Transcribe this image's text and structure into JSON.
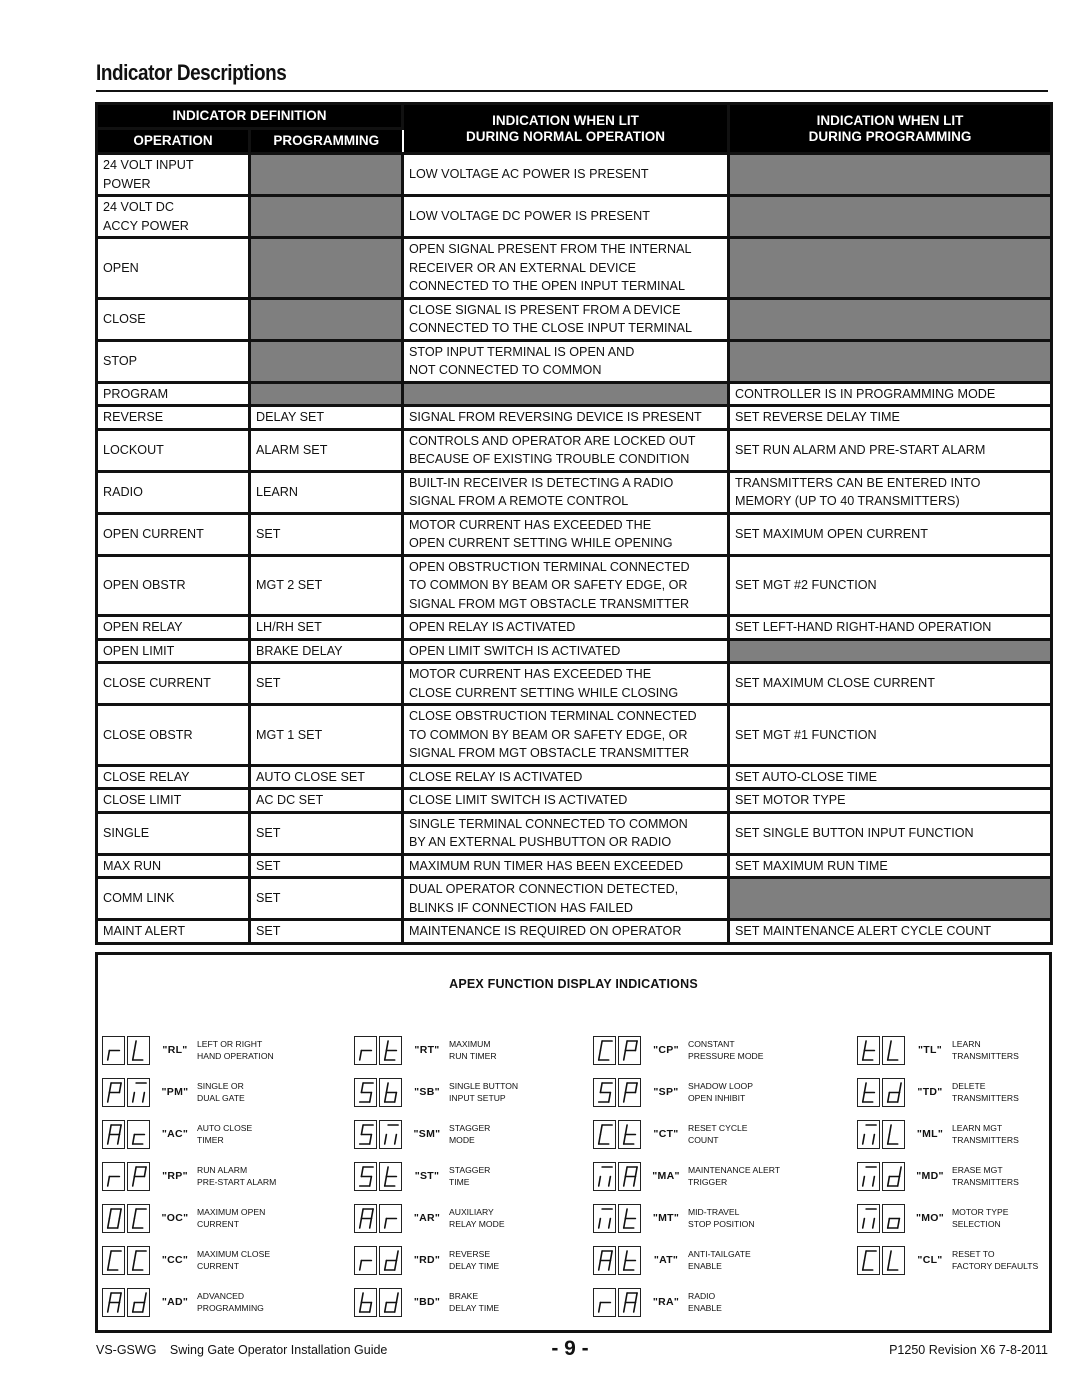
{
  "page": {
    "title": "Indicator Descriptions"
  },
  "table": {
    "headers": {
      "indicator_definition": "INDICATOR DEFINITION",
      "operation": "OPERATION",
      "programming": "PROGRAMMING",
      "lit_normal_line1": "INDICATION WHEN LIT",
      "lit_normal_line2": "DURING NORMAL OPERATION",
      "lit_prog_line1": "INDICATION WHEN LIT",
      "lit_prog_line2": "DURING PROGRAMMING"
    },
    "rows": [
      {
        "operation": "24 VOLT INPUT\nPOWER",
        "programming": null,
        "normal": "LOW VOLTAGE AC POWER IS PRESENT",
        "prog": null
      },
      {
        "operation": "24 VOLT DC\nACCY POWER",
        "programming": null,
        "normal": "LOW VOLTAGE DC POWER IS PRESENT",
        "prog": null
      },
      {
        "operation": "OPEN",
        "programming": null,
        "normal": "OPEN SIGNAL PRESENT FROM THE INTERNAL\nRECEIVER OR AN EXTERNAL DEVICE\nCONNECTED TO THE OPEN INPUT TERMINAL",
        "prog": null
      },
      {
        "operation": "CLOSE",
        "programming": null,
        "normal": "CLOSE SIGNAL IS PRESENT FROM A DEVICE\nCONNECTED TO THE CLOSE INPUT TERMINAL",
        "prog": null
      },
      {
        "operation": "STOP",
        "programming": null,
        "normal": "STOP INPUT TERMINAL IS OPEN AND\nNOT CONNECTED TO COMMON",
        "prog": null
      },
      {
        "operation": "PROGRAM",
        "programming": null,
        "normal": null,
        "prog": "CONTROLLER IS IN PROGRAMMING MODE"
      },
      {
        "operation": "REVERSE",
        "programming": "DELAY SET",
        "normal": "SIGNAL FROM REVERSING DEVICE IS PRESENT",
        "prog": "SET REVERSE DELAY TIME"
      },
      {
        "operation": "LOCKOUT",
        "programming": "ALARM SET",
        "normal": "CONTROLS AND OPERATOR ARE LOCKED OUT\nBECAUSE OF EXISTING TROUBLE CONDITION",
        "prog": "SET RUN ALARM AND PRE-START ALARM"
      },
      {
        "operation": "RADIO",
        "programming": "LEARN",
        "normal": "BUILT-IN RECEIVER IS DETECTING A RADIO\nSIGNAL FROM A REMOTE CONTROL",
        "prog": "TRANSMITTERS CAN BE ENTERED INTO\nMEMORY (UP TO 40 TRANSMITTERS)"
      },
      {
        "operation": "OPEN CURRENT",
        "programming": "SET",
        "normal": "MOTOR CURRENT HAS EXCEEDED THE\nOPEN CURRENT SETTING WHILE OPENING",
        "prog": "SET MAXIMUM OPEN CURRENT"
      },
      {
        "operation": "OPEN OBSTR",
        "programming": "MGT 2 SET",
        "normal": "OPEN OBSTRUCTION TERMINAL CONNECTED\nTO COMMON BY BEAM OR SAFETY EDGE, OR\nSIGNAL FROM MGT OBSTACLE TRANSMITTER",
        "prog": "SET MGT #2 FUNCTION"
      },
      {
        "operation": "OPEN RELAY",
        "programming": "LH/RH SET",
        "normal": "OPEN RELAY IS ACTIVATED",
        "prog": "SET LEFT-HAND RIGHT-HAND OPERATION"
      },
      {
        "operation": "OPEN LIMIT",
        "programming": "BRAKE DELAY",
        "normal": "OPEN LIMIT SWITCH IS ACTIVATED",
        "prog": null
      },
      {
        "operation": "CLOSE CURRENT",
        "programming": "SET",
        "normal": "MOTOR CURRENT HAS EXCEEDED THE\nCLOSE CURRENT SETTING WHILE CLOSING",
        "prog": "SET MAXIMUM CLOSE CURRENT"
      },
      {
        "operation": "CLOSE OBSTR",
        "programming": "MGT 1 SET",
        "normal": "CLOSE OBSTRUCTION TERMINAL CONNECTED\nTO COMMON BY BEAM OR SAFETY EDGE, OR\nSIGNAL FROM MGT OBSTACLE TRANSMITTER",
        "prog": "SET MGT #1 FUNCTION"
      },
      {
        "operation": "CLOSE RELAY",
        "programming": "AUTO CLOSE SET",
        "normal": "CLOSE RELAY IS ACTIVATED",
        "prog": "SET AUTO-CLOSE TIME"
      },
      {
        "operation": "CLOSE LIMIT",
        "programming": "AC DC SET",
        "normal": "CLOSE LIMIT SWITCH IS ACTIVATED",
        "prog": "SET MOTOR TYPE"
      },
      {
        "operation": "SINGLE",
        "programming": "SET",
        "normal": "SINGLE TERMINAL CONNECTED TO COMMON\nBY AN EXTERNAL PUSHBUTTON OR RADIO",
        "prog": "SET SINGLE BUTTON INPUT FUNCTION"
      },
      {
        "operation": "MAX RUN",
        "programming": "SET",
        "normal": "MAXIMUM RUN TIMER HAS BEEN EXCEEDED",
        "prog": "SET MAXIMUM RUN TIME"
      },
      {
        "operation": "COMM LINK",
        "programming": "SET",
        "normal": "DUAL OPERATOR CONNECTION DETECTED,\nBLINKS IF CONNECTION HAS FAILED",
        "prog": null
      },
      {
        "operation": "MAINT ALERT",
        "programming": "SET",
        "normal": "MAINTENANCE IS REQUIRED ON OPERATOR",
        "prog": "SET MAINTENANCE ALERT CYCLE COUNT"
      }
    ]
  },
  "apex": {
    "title": "APEX FUNCTION DISPLAY INDICATIONS",
    "columns": [
      [
        {
          "glyphs": [
            "r",
            "L"
          ],
          "code": "\"RL\"",
          "desc": "LEFT OR RIGHT\nHAND OPERATION"
        },
        {
          "glyphs": [
            "P",
            "m"
          ],
          "code": "\"PM\"",
          "desc": "SINGLE OR\nDUAL GATE"
        },
        {
          "glyphs": [
            "A",
            "c"
          ],
          "code": "\"AC\"",
          "desc": "AUTO CLOSE\nTIMER"
        },
        {
          "glyphs": [
            "r",
            "P"
          ],
          "code": "\"RP\"",
          "desc": "RUN ALARM\nPRE-START ALARM"
        },
        {
          "glyphs": [
            "O",
            "C"
          ],
          "code": "\"OC\"",
          "desc": "MAXIMUM OPEN\nCURRENT"
        },
        {
          "glyphs": [
            "C",
            "C"
          ],
          "code": "\"CC\"",
          "desc": "MAXIMUM CLOSE\nCURRENT"
        },
        {
          "glyphs": [
            "A",
            "d"
          ],
          "code": "\"AD\"",
          "desc": "ADVANCED\nPROGRAMMING"
        }
      ],
      [
        {
          "glyphs": [
            "r",
            "t"
          ],
          "code": "\"RT\"",
          "desc": "MAXIMUM\nRUN TIMER"
        },
        {
          "glyphs": [
            "S",
            "b"
          ],
          "code": "\"SB\"",
          "desc": "SINGLE BUTTON\nINPUT SETUP"
        },
        {
          "glyphs": [
            "S",
            "m"
          ],
          "code": "\"SM\"",
          "desc": "STAGGER\nMODE"
        },
        {
          "glyphs": [
            "S",
            "t"
          ],
          "code": "\"ST\"",
          "desc": "STAGGER\nTIME"
        },
        {
          "glyphs": [
            "A",
            "r"
          ],
          "code": "\"AR\"",
          "desc": "AUXILIARY\nRELAY MODE"
        },
        {
          "glyphs": [
            "r",
            "d"
          ],
          "code": "\"RD\"",
          "desc": "REVERSE\nDELAY TIME"
        },
        {
          "glyphs": [
            "b",
            "d"
          ],
          "code": "\"BD\"",
          "desc": "BRAKE\nDELAY TIME"
        }
      ],
      [
        {
          "glyphs": [
            "C",
            "P"
          ],
          "code": "\"CP\"",
          "desc": "CONSTANT\nPRESSURE MODE"
        },
        {
          "glyphs": [
            "S",
            "P"
          ],
          "code": "\"SP\"",
          "desc": "SHADOW LOOP\nOPEN INHIBIT"
        },
        {
          "glyphs": [
            "C",
            "t"
          ],
          "code": "\"CT\"",
          "desc": "RESET CYCLE\nCOUNT"
        },
        {
          "glyphs": [
            "m",
            "A"
          ],
          "code": "\"MA\"",
          "desc": "MAINTENANCE ALERT\nTRIGGER"
        },
        {
          "glyphs": [
            "m",
            "t"
          ],
          "code": "\"MT\"",
          "desc": "MID-TRAVEL\nSTOP POSITION"
        },
        {
          "glyphs": [
            "A",
            "t"
          ],
          "code": "\"AT\"",
          "desc": "ANTI-TAILGATE\nENABLE"
        },
        {
          "glyphs": [
            "r",
            "A"
          ],
          "code": "\"RA\"",
          "desc": "RADIO\nENABLE"
        }
      ],
      [
        {
          "glyphs": [
            "t",
            "L"
          ],
          "code": "\"TL\"",
          "desc": "LEARN\nTRANSMITTERS"
        },
        {
          "glyphs": [
            "t",
            "d"
          ],
          "code": "\"TD\"",
          "desc": "DELETE\nTRANSMITTERS"
        },
        {
          "glyphs": [
            "m",
            "L"
          ],
          "code": "\"ML\"",
          "desc": "LEARN MGT\nTRANSMITTERS"
        },
        {
          "glyphs": [
            "m",
            "d"
          ],
          "code": "\"MD\"",
          "desc": "ERASE MGT\nTRANSMITTERS"
        },
        {
          "glyphs": [
            "m",
            "o"
          ],
          "code": "\"MO\"",
          "desc": "MOTOR TYPE\nSELECTION"
        },
        {
          "glyphs": [
            "C",
            "L"
          ],
          "code": "\"CL\"",
          "desc": "RESET TO\nFACTORY DEFAULTS"
        }
      ]
    ]
  },
  "footer": {
    "doc_code": "VS-GSWG",
    "doc_title": "Swing Gate Operator Installation Guide",
    "page_number": "- 9 -",
    "revision": "P1250 Revision X6 7-8-2011"
  }
}
